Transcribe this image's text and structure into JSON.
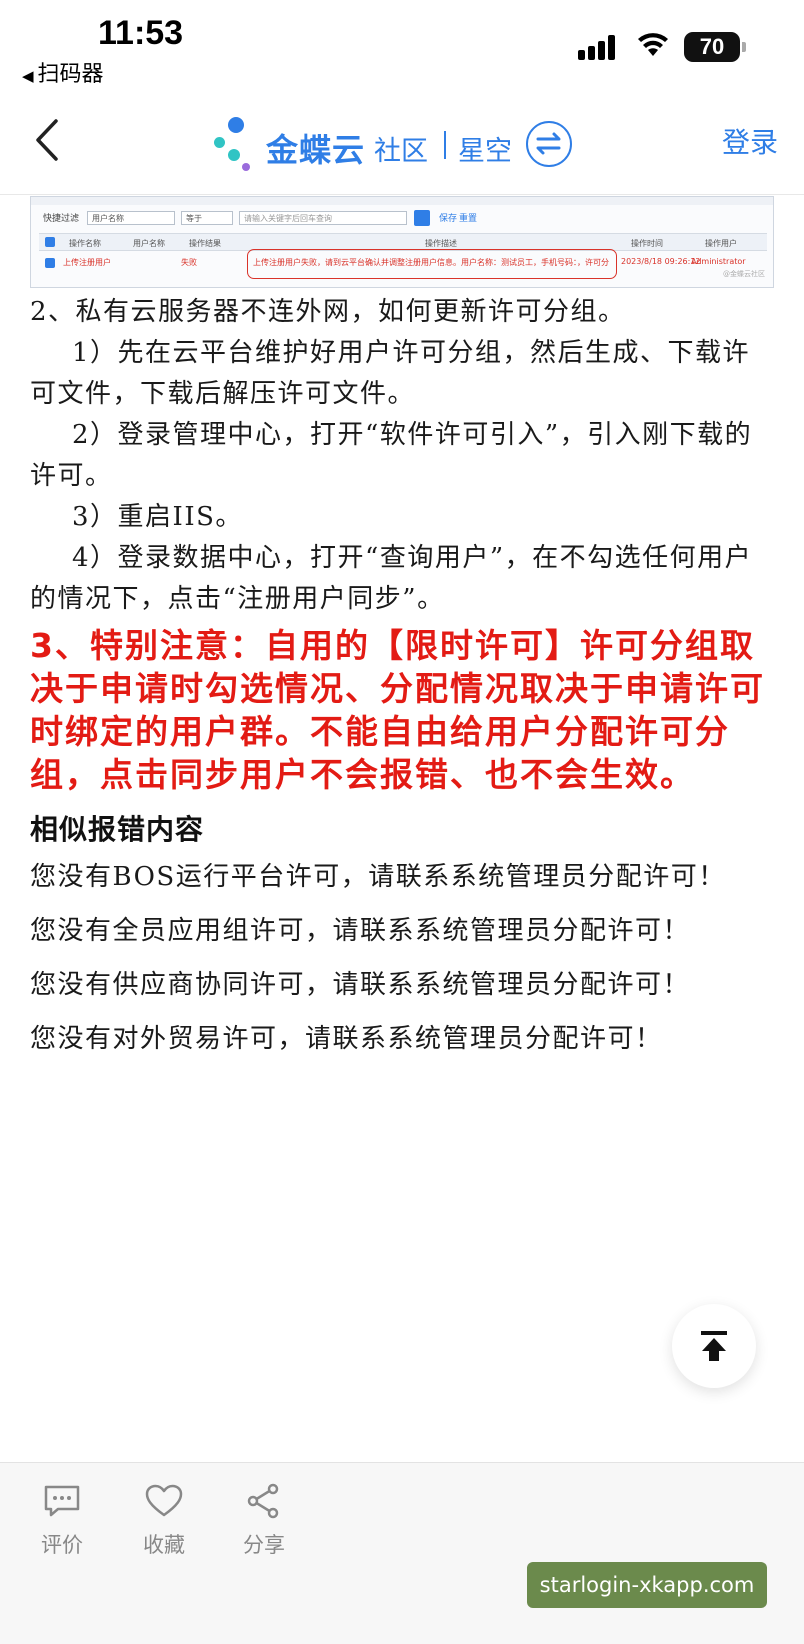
{
  "status_bar": {
    "time": "11:53",
    "back_app": "扫码器",
    "battery": "70"
  },
  "header": {
    "brand_main": "金蝶云",
    "brand_sub": "社区",
    "brand_product": "星空",
    "login_label": "登录"
  },
  "embedded_table": {
    "filter_label": "快捷过滤",
    "filter_field": "用户名称",
    "filter_op": "等于",
    "filter_placeholder": "请输入关键字后回车查询",
    "save_label": "保存",
    "reset_label": "重置",
    "columns": [
      "操作名称",
      "用户名称",
      "操作结果",
      "操作描述",
      "操作时间",
      "操作用户"
    ],
    "row": {
      "name": "上传注册用户",
      "result": "失败",
      "desc": "上传注册用户失败，请到云平台确认并调整注册用户信息。用户名称：测试员工，手机号码：，许可分",
      "time": "2023/8/18 09:26:12",
      "user": "Administrator"
    },
    "watermark": "@金蝶云社区"
  },
  "article": {
    "p1": "2、私有云服务器不连外网，如何更新许可分组。",
    "p2": "1）先在云平台维护好用户许可分组，然后生成、下载许可文件，下载后解压许可文件。",
    "p3": "2）登录管理中心，打开“软件许可引入”，引入刚下载的许可。",
    "p4": "3）重启IIS。",
    "p5": "4）登录数据中心，打开“查询用户”，在不勾选任何用户的情况下，点击“注册用户同步”。",
    "warning": "3、特别注意：自用的【限时许可】许可分组取决于申请时勾选情况、分配情况取决于申请许可时绑定的用户群。不能自由给用户分配许可分组，点击同步用户不会报错、也不会生效。",
    "similar_heading": "相似报错内容",
    "errors": [
      "您没有BOS运行平台许可，请联系系统管理员分配许可！",
      "您没有全员应用组许可，请联系系统管理员分配许可！",
      "您没有供应商协同许可，请联系系统管理员分配许可！",
      "您没有对外贸易许可，请联系系统管理员分配许可！"
    ]
  },
  "bottom_bar": {
    "comment_label": "评价",
    "favorite_label": "收藏",
    "share_label": "分享"
  },
  "watermark": "starlogin-xkapp.com",
  "colors": {
    "brand_blue": "#2f7ee6",
    "warning_red": "#e31b14",
    "watermark_green": "#6b8a4c"
  }
}
